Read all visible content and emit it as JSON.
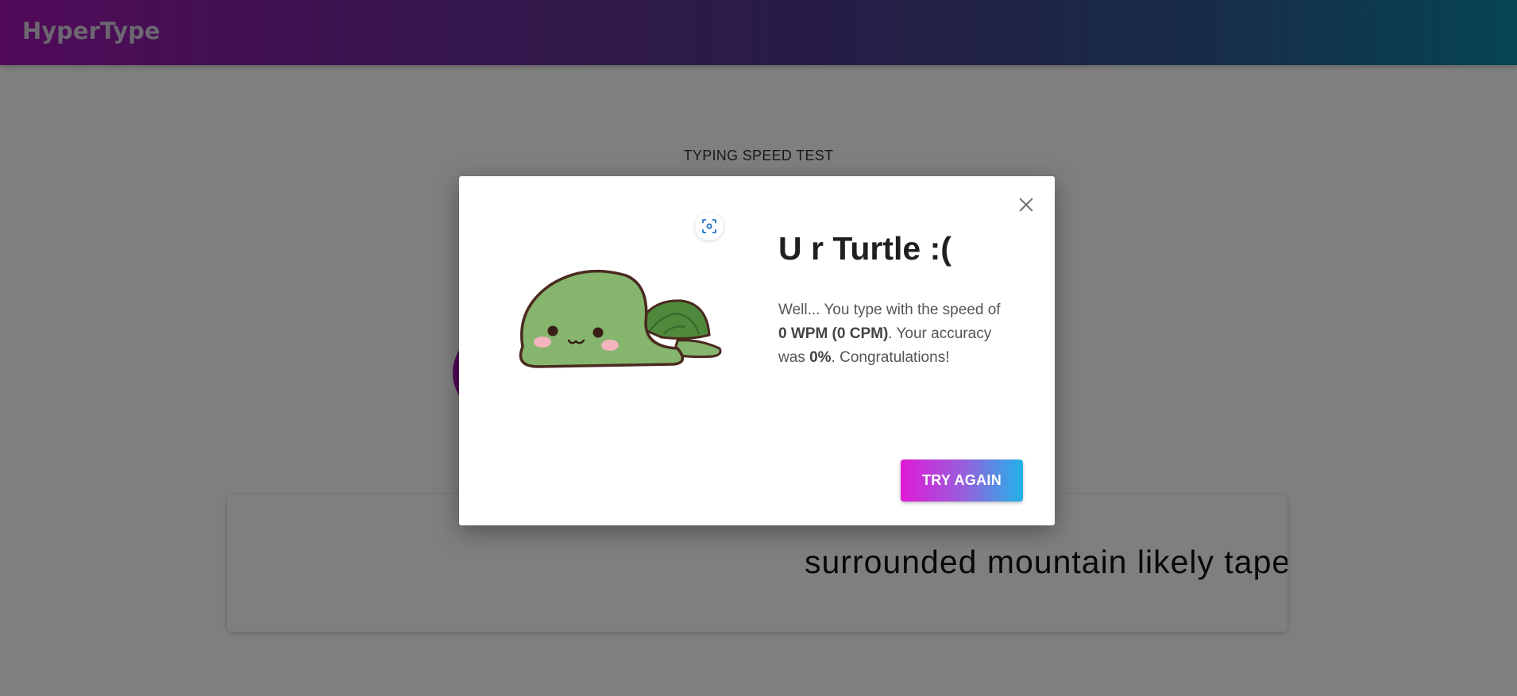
{
  "header": {
    "brand": "HyperType"
  },
  "page": {
    "label": "TYPING SPEED TEST",
    "typing_text": "surrounded mountain likely tape"
  },
  "modal": {
    "title": "U r Turtle :(",
    "text_prefix": "Well... You type with the speed of ",
    "speed": "0 WPM (0 CPM)",
    "text_mid": ". Your accuracy was ",
    "accuracy": "0%",
    "text_suffix": ". Congratulations!",
    "button_label": "TRY AGAIN",
    "image_alt": "turtle-illustration"
  },
  "colors": {
    "accent_magenta": "#a315b3",
    "accent_cyan": "#0c8aa5",
    "button_start": "#e01ad6",
    "button_end": "#22b3e8",
    "turtle_body": "#86b56e",
    "turtle_shell": "#4f8a3c"
  }
}
